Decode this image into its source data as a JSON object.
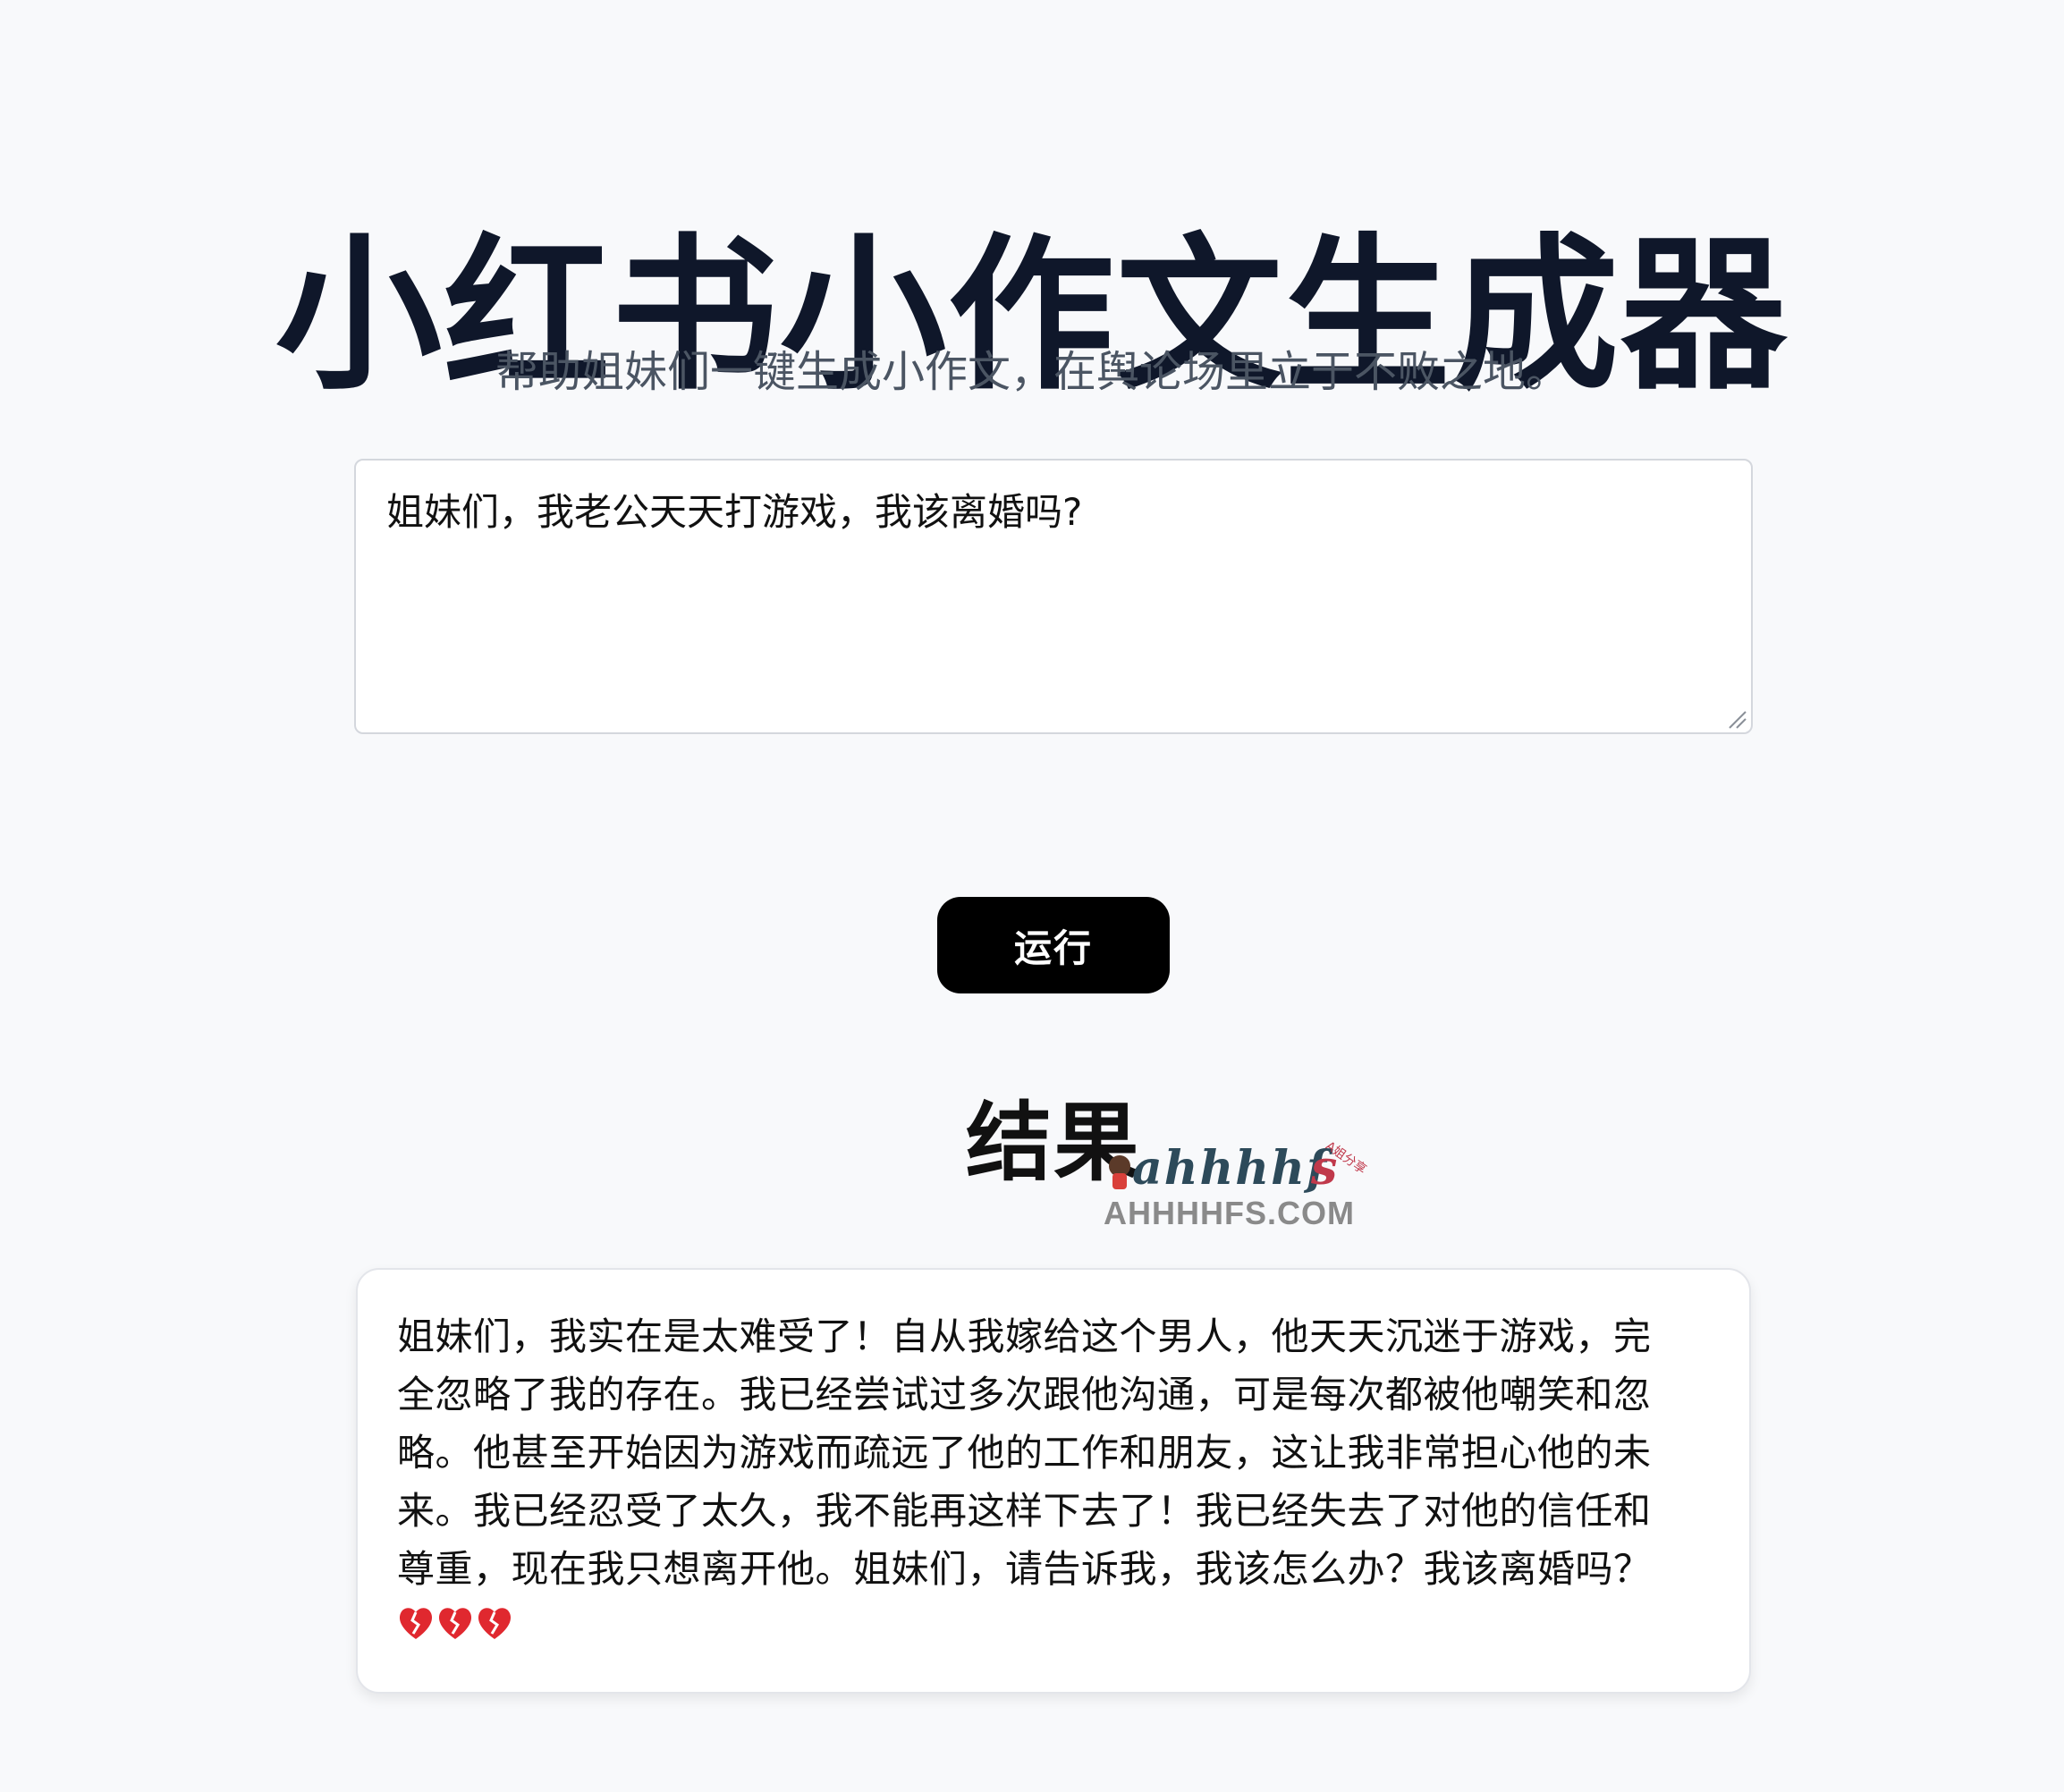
{
  "header": {
    "title": "小红书小作文生成器",
    "subtitle": "帮助姐妹们一键生成小作文，在舆论场里立于不败之地。"
  },
  "input": {
    "value": "姐妹们，我老公天天打游戏，我该离婚吗?"
  },
  "actions": {
    "run_label": "运行"
  },
  "result": {
    "heading": "结果",
    "text": "姐妹们，我实在是太难受了！自从我嫁给这个男人，他天天沉迷于游戏，完全忽略了我的存在。我已经尝试过多次跟他沟通，可是每次都被他嘲笑和忽略。他甚至开始因为游戏而疏远了他的工作和朋友，这让我非常担心他的未来。我已经忍受了太久，我不能再这样下去了！我已经失去了对他的信任和尊重，现在我只想离开他。姐妹们，请告诉我，我该怎么办？我该离婚吗？",
    "emoji": [
      "broken-heart-icon",
      "broken-heart-icon",
      "broken-heart-icon"
    ]
  },
  "watermark": {
    "logo_text": "ahhhhfs",
    "tag_text": "A姐分享",
    "site": "AHHHHFS.COM"
  },
  "colors": {
    "background": "#f8f9fb",
    "title": "#0f172a",
    "subtitle": "#4b5563",
    "button": "#000000",
    "heart": "#e0282f"
  }
}
